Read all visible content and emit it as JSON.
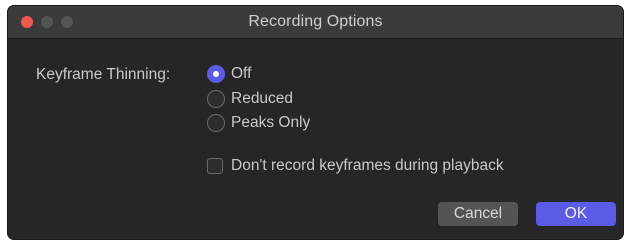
{
  "window": {
    "title": "Recording Options"
  },
  "keyframe_thinning": {
    "label": "Keyframe Thinning:",
    "options": [
      {
        "label": "Off",
        "selected": true
      },
      {
        "label": "Reduced",
        "selected": false
      },
      {
        "label": "Peaks Only",
        "selected": false
      }
    ]
  },
  "playback_checkbox": {
    "label": "Don't record keyframes during playback",
    "checked": false
  },
  "buttons": {
    "cancel_label": "Cancel",
    "ok_label": "OK"
  },
  "colors": {
    "accent": "#5b5be6",
    "close": "#ee5a52",
    "background": "#262626",
    "titlebar": "#3b3b3b"
  }
}
